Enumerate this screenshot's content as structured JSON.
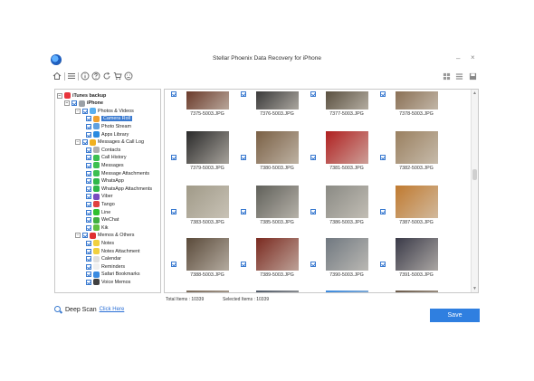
{
  "window": {
    "title": "Stellar Phoenix Data Recovery for iPhone"
  },
  "icons": {
    "app_logo": "app-logo-icon",
    "home": "home-icon",
    "menu": "menu-icon",
    "info": "info-icon",
    "help": "help-icon",
    "refresh": "refresh-icon",
    "cart": "cart-icon",
    "feedback": "smiley-icon"
  },
  "tree": {
    "items": [
      {
        "label": "iTunes backup",
        "bold": true,
        "level": 0,
        "icon_color": "#e8343c"
      },
      {
        "label": "iPhone",
        "bold": true,
        "level": 1,
        "icon_color": "#9aa0a6"
      },
      {
        "label": "Photos & Videos",
        "level": 2,
        "icon_color": "#5ab0f0"
      },
      {
        "label": "Camera Roll",
        "level": 3,
        "icon_color": "#f0a030",
        "selected": true
      },
      {
        "label": "Photo Stream",
        "level": 3,
        "icon_color": "#60a0e0"
      },
      {
        "label": "Apps Library",
        "level": 3,
        "icon_color": "#2a8ae0"
      },
      {
        "label": "Messages & Call Log",
        "level": 2,
        "icon_color": "#f0b020"
      },
      {
        "label": "Contacts",
        "level": 3,
        "icon_color": "#b0b0b0"
      },
      {
        "label": "Call History",
        "level": 3,
        "icon_color": "#3cc050"
      },
      {
        "label": "Messages",
        "level": 3,
        "icon_color": "#3cc050"
      },
      {
        "label": "Message Attachments",
        "level": 3,
        "icon_color": "#3cc050"
      },
      {
        "label": "WhatsApp",
        "level": 3,
        "icon_color": "#2fb84a"
      },
      {
        "label": "WhatsApp Attachments",
        "level": 3,
        "icon_color": "#2fb84a"
      },
      {
        "label": "Viber",
        "level": 3,
        "icon_color": "#7a4cc0"
      },
      {
        "label": "Tango",
        "level": 3,
        "icon_color": "#e04040"
      },
      {
        "label": "Line",
        "level": 3,
        "icon_color": "#30c030"
      },
      {
        "label": "WeChat",
        "level": 3,
        "icon_color": "#40b040"
      },
      {
        "label": "Kik",
        "level": 3,
        "icon_color": "#60c040"
      },
      {
        "label": "Memos & Others",
        "level": 2,
        "icon_color": "#e03030"
      },
      {
        "label": "Notes",
        "level": 3,
        "icon_color": "#f0d040"
      },
      {
        "label": "Notes Attachment",
        "level": 3,
        "icon_color": "#f0d040"
      },
      {
        "label": "Calendar",
        "level": 3,
        "icon_color": "#e0e0e0"
      },
      {
        "label": "Reminders",
        "level": 3,
        "icon_color": "#f0f0f0"
      },
      {
        "label": "Safari Bookmarks",
        "level": 3,
        "icon_color": "#3a8ae0"
      },
      {
        "label": "Voice Memos",
        "level": 3,
        "icon_color": "#404040"
      }
    ]
  },
  "grid": {
    "rows": [
      [
        {
          "name": "7375-5003.JPG",
          "color": "#6a3a2a"
        },
        {
          "name": "7376-5003.JPG",
          "color": "#3a3a3a"
        },
        {
          "name": "7377-5003.JPG",
          "color": "#5a5040"
        },
        {
          "name": "7378-5003.JPG",
          "color": "#8a7055"
        }
      ],
      [
        {
          "name": "7379-5003.JPG",
          "color": "#2a2a2a"
        },
        {
          "name": "7380-5003.JPG",
          "color": "#7a6045"
        },
        {
          "name": "7381-5003.JPG",
          "color": "#b02020"
        },
        {
          "name": "7382-5003.JPG",
          "color": "#9a8060"
        }
      ],
      [
        {
          "name": "7383-5003.JPG",
          "color": "#a09a88"
        },
        {
          "name": "7385-5003.JPG",
          "color": "#60605a"
        },
        {
          "name": "7386-5003.JPG",
          "color": "#8a8a84"
        },
        {
          "name": "7387-5003.JPG",
          "color": "#c07a30"
        }
      ],
      [
        {
          "name": "7388-5003.JPG",
          "color": "#5a4a3a"
        },
        {
          "name": "7389-5003.JPG",
          "color": "#7a2a20"
        },
        {
          "name": "7390-5003.JPG",
          "color": "#707880"
        },
        {
          "name": "7391-5003.JPG",
          "color": "#3a3a48"
        }
      ],
      [
        {
          "name": "",
          "color": "#7a6a5a"
        },
        {
          "name": "",
          "color": "#505a68"
        },
        {
          "name": "",
          "color": "#3a8ae0"
        },
        {
          "name": "",
          "color": "#6a5a4a"
        }
      ]
    ]
  },
  "status": {
    "total_items": "Total Items : 10339",
    "selected_items": "Selected Items : 10339"
  },
  "deep_scan": {
    "label": "Deep Scan",
    "link": "Click Here"
  },
  "buttons": {
    "save": "Save"
  }
}
